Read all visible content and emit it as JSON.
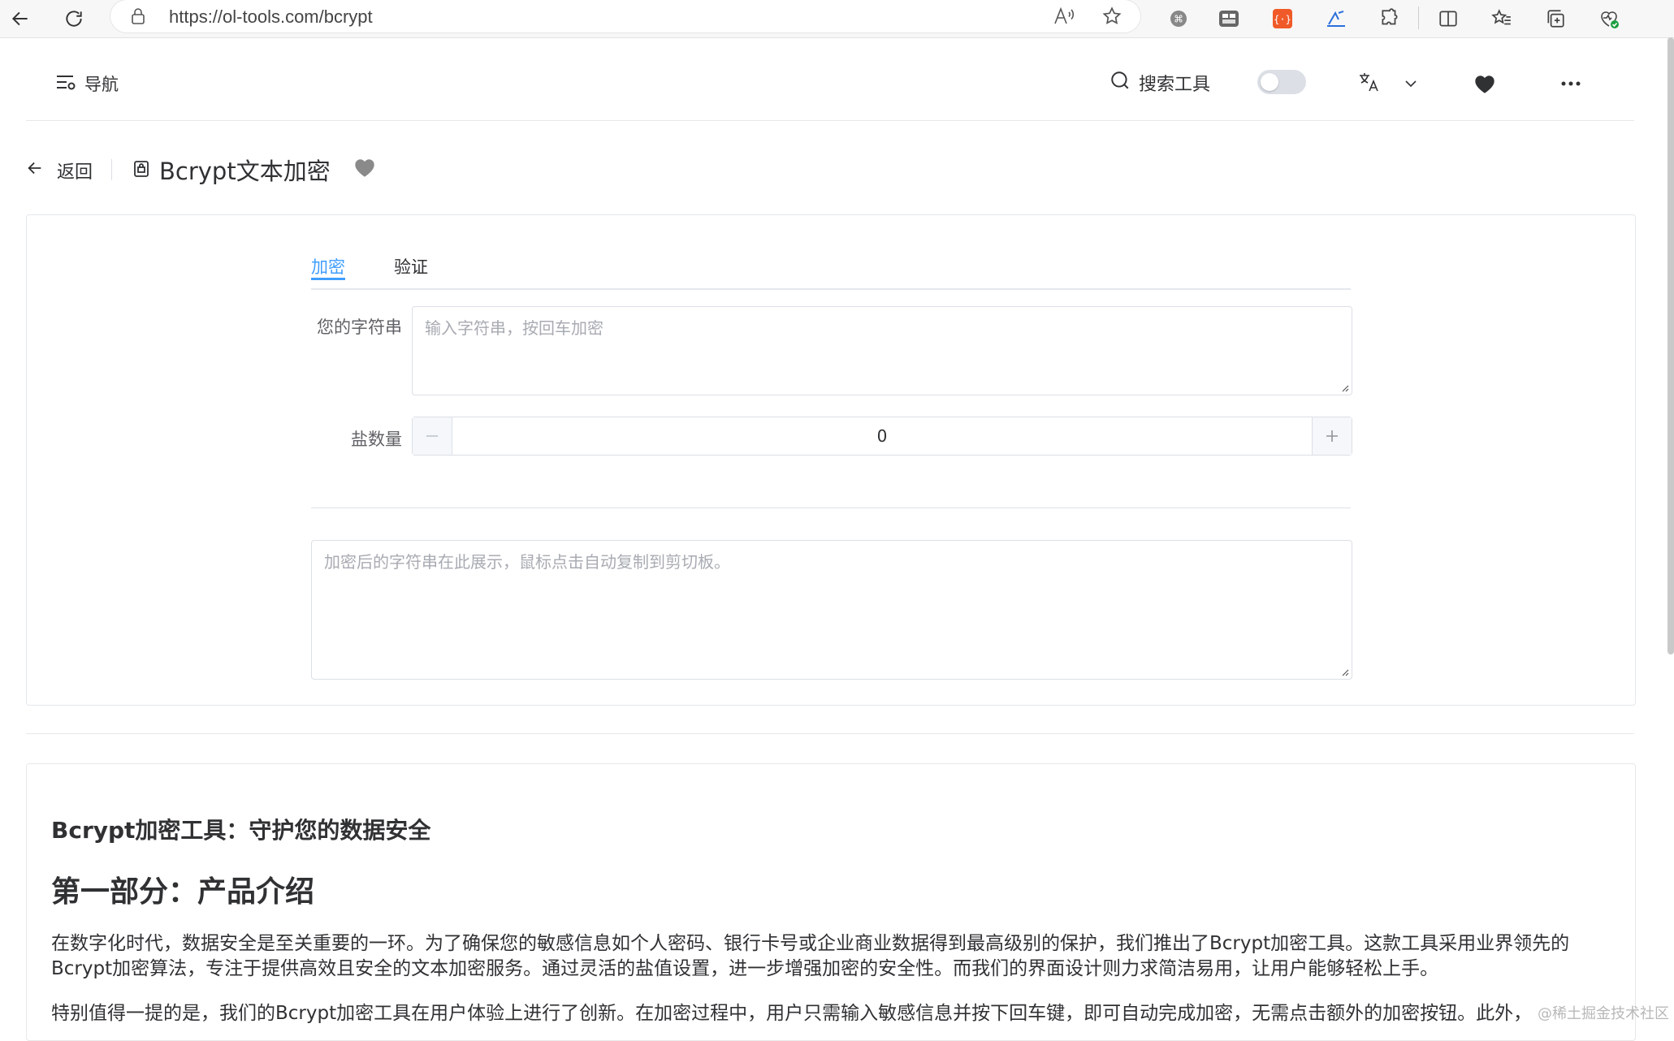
{
  "browser": {
    "url": "https://ol-tools.com/bcrypt",
    "ext_badge": "{·}"
  },
  "header": {
    "nav_label": "导航",
    "search_label": "搜索工具"
  },
  "page": {
    "back_label": "返回",
    "tool_title": "Bcrypt文本加密"
  },
  "tool": {
    "tabs": [
      {
        "label": "加密",
        "active": true
      },
      {
        "label": "验证",
        "active": false
      }
    ],
    "input_label": "您的字符串",
    "input_placeholder": "输入字符串，按回车加密",
    "salt_label": "盐数量",
    "salt_value": "0",
    "output_placeholder": "加密后的字符串在此展示，鼠标点击自动复制到剪切板。"
  },
  "article": {
    "heading": "Bcrypt加密工具：守护您的数据安全",
    "section_title": "第一部分：产品介绍",
    "para1": "在数字化时代，数据安全是至关重要的一环。为了确保您的敏感信息如个人密码、银行卡号或企业商业数据得到最高级别的保护，我们推出了Bcrypt加密工具。这款工具采用业界领先的Bcrypt加密算法，专注于提供高效且安全的文本加密服务。通过灵活的盐值设置，进一步增强加密的安全性。而我们的界面设计则力求简洁易用，让用户能够轻松上手。",
    "para2": "特别值得一提的是，我们的Bcrypt加密工具在用户体验上进行了创新。在加密过程中，用户只需输入敏感信息并按下回车键，即可自动完成加密，无需点击额外的加密按钮。此外，"
  },
  "watermark": "@稀土掘金技术社区",
  "colors": {
    "accent": "#409eff",
    "border": "#dcdfe6",
    "text": "#303133"
  }
}
